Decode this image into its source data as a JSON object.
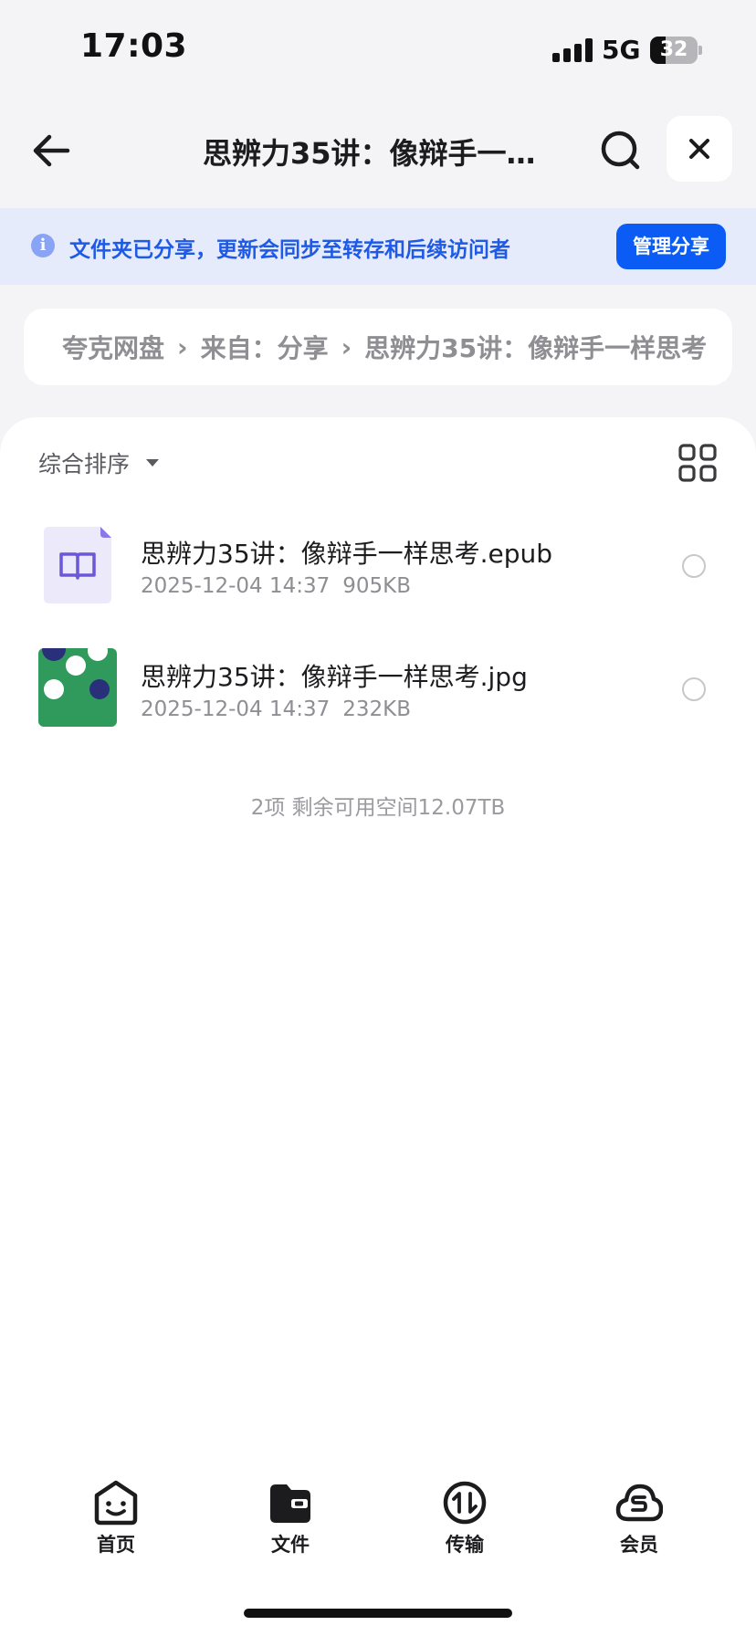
{
  "status_bar": {
    "time": "17:03",
    "network": "5G",
    "battery_percent": "32"
  },
  "nav": {
    "title": "思辨力35讲：像辩手一样思考",
    "back_icon": "arrow-left-icon",
    "search_icon": "search-icon",
    "close_icon": "close-icon"
  },
  "share_banner": {
    "text": "文件夹已分享，更新会同步至转存和后续访问者",
    "button_label": "管理分享",
    "accent_color": "#0b5cf5"
  },
  "breadcrumb": {
    "items": [
      "夸克网盘",
      "来自：分享",
      "思辨力35讲：像辩手一样思考"
    ]
  },
  "toolbar": {
    "sort_label": "综合排序",
    "view_toggle_icon": "grid-view-icon"
  },
  "files": [
    {
      "name": "思辨力35讲：像辩手一样思考.epub",
      "date": "2025-12-04 14:37",
      "size": "905KB",
      "icon": "epub-book-icon"
    },
    {
      "name": "思辨力35讲：像辩手一样思考.jpg",
      "date": "2025-12-04 14:37",
      "size": "232KB",
      "icon": "image-thumbnail"
    }
  ],
  "summary": "2项 剩余可用空间12.07TB",
  "tab_bar": {
    "items": [
      {
        "label": "首页",
        "icon": "home-smile-icon"
      },
      {
        "label": "文件",
        "icon": "folder-icon"
      },
      {
        "label": "传输",
        "icon": "transfer-icon"
      },
      {
        "label": "会员",
        "icon": "member-cloud-icon"
      }
    ]
  }
}
